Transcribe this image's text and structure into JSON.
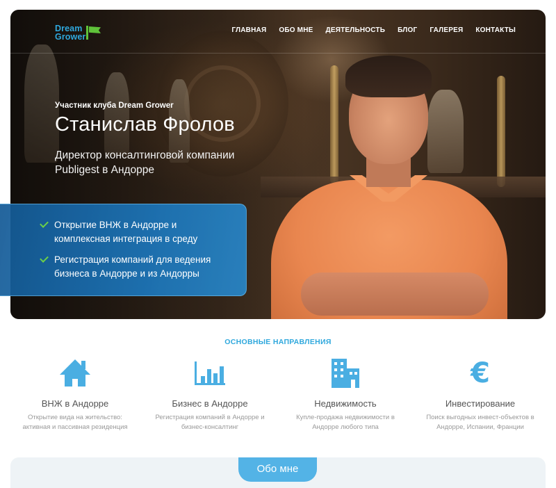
{
  "logo": {
    "line1": "Dream",
    "line2": "Grower"
  },
  "nav": {
    "items": [
      "ГЛАВНАЯ",
      "ОБО МНЕ",
      "ДЕЯТЕЛЬНОСТЬ",
      "БЛОГ",
      "ГАЛЕРЕЯ",
      "КОНТАКТЫ"
    ]
  },
  "hero": {
    "club": "Участник клуба Dream Grower",
    "name": "Станислав Фролов",
    "role": "Директор консалтинговой компании Publigest в Андорре",
    "features": [
      "Открытие ВНЖ в Андорре и комплексная интеграция в среду",
      "Регистрация компаний для ведения бизнеса в Андорре и из Андорры"
    ]
  },
  "directions": {
    "title": "ОСНОВНЫЕ НАПРАВЛЕНИЯ",
    "items": [
      {
        "icon": "house-icon",
        "title": "ВНЖ в Андорре",
        "desc": "Открытие вида на жительство: активная и пассивная резиденция"
      },
      {
        "icon": "bar-chart-icon",
        "title": "Бизнес в Андорре",
        "desc": "Регистрация компаний в Андорре и бизнес-консалтинг"
      },
      {
        "icon": "buildings-icon",
        "title": "Недвижимость",
        "desc": "Купле-продажа недвижимости в Андорре любого типа"
      },
      {
        "icon": "euro-icon",
        "title": "Инвестирование",
        "desc": "Поиск выгодных инвест-объектов в Андорре, Испании, Франции"
      }
    ]
  },
  "about": {
    "label": "Обо мне"
  },
  "colors": {
    "accent": "#2fa8dd",
    "icon": "#4aaee2",
    "check": "#6cd048",
    "logo_flag": "#5fc23a"
  }
}
